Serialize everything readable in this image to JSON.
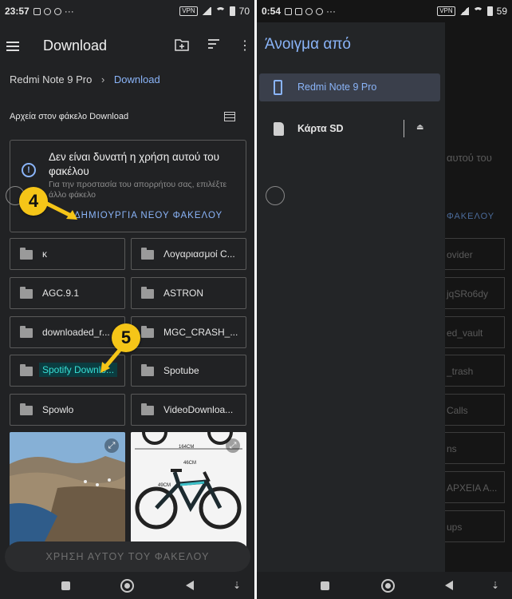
{
  "left": {
    "status": {
      "time": "23:57",
      "vpn": "VPN",
      "battery": "70"
    },
    "app_title": "Download",
    "breadcrumb": {
      "root": "Redmi Note 9 Pro",
      "current": "Download"
    },
    "section_title": "Αρχεία στον φάκελο Download",
    "warning": {
      "title": "Δεν είναι δυνατή η χρήση αυτού του φακέλου",
      "subtitle": "Για την προστασία του απορρήτου σας, επιλέξτε άλλο φάκελο",
      "action": "ΔΗΜΙΟΥΡΓΙΑ ΝΕΟΥ ΦΑΚΕΛΟΥ"
    },
    "folders": [
      "κ",
      "Λογαριασμοί C...",
      "AGC.9.1",
      "ASTRON",
      "downloaded_r...",
      "MGC_CRASH_...",
      "Spotify Downlo...",
      "Spotube",
      "Spowlo",
      "VideoDownloa..."
    ],
    "selected_folder": "Spotify Downlo...",
    "thumb_labels": [
      "164CM",
      "46CM",
      "49CM"
    ],
    "use_button": "ΧΡΗΣΗ ΑΥΤΟΥ ΤΟΥ ΦΑΚΕΛΟΥ",
    "step_badges": [
      "4",
      "5"
    ]
  },
  "right": {
    "status": {
      "time": "0:54",
      "vpn": "VPN",
      "battery": "59"
    },
    "drawer_title": "Άνοιγμα από",
    "items": [
      {
        "label": "Redmi Note 9 Pro",
        "icon": "phone-icon",
        "selected": true
      },
      {
        "label": "Κάρτα SD",
        "icon": "sd-card-icon",
        "selected": false
      }
    ],
    "background_labels": [
      "αυτού του",
      "ΦΑΚΕΛΟΥ",
      "ovider",
      "jqSRo6dy",
      "ed_vault",
      "_trash",
      "Calls",
      "ns",
      "ΑΡΧΕΙΑ Α...",
      "ups"
    ]
  },
  "colors": {
    "accent": "#8ab4f8",
    "selected_bg": "#0b3c40",
    "selected_text": "#37e0d6",
    "badge": "#f5c518",
    "surface": "#212224"
  }
}
